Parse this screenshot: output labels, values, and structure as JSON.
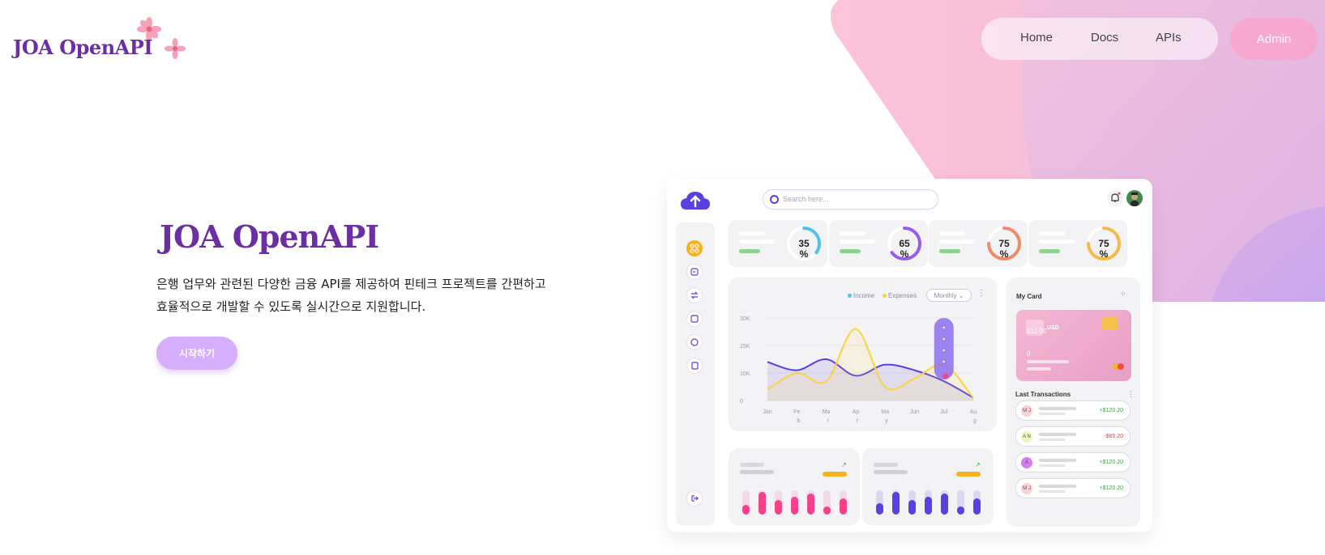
{
  "brand": {
    "logo_text": "JOA OpenAPI"
  },
  "nav": {
    "items": [
      {
        "label": "Home"
      },
      {
        "label": "Docs"
      },
      {
        "label": "APIs"
      }
    ],
    "admin_label": "Admin"
  },
  "hero": {
    "title": "JOA OpenAPI",
    "description_line1": "은행 업무와 관련된 다양한 금융 API를 제공하여 핀테크 프로젝트를 간편하고",
    "description_line2": "효율적으로 개발할 수 있도록 실시간으로 지원합니다.",
    "cta_label": "시작하기"
  },
  "dashboard": {
    "search_placeholder": "Search here...",
    "stats": [
      {
        "value": "35",
        "unit": "%",
        "percent": 35,
        "color": "#4fc3e8"
      },
      {
        "value": "65",
        "unit": "%",
        "percent": 65,
        "color": "#9a5cf0"
      },
      {
        "value": "75",
        "unit": "%",
        "percent": 75,
        "color": "#f28a6a"
      },
      {
        "value": "75",
        "unit": "%",
        "percent": 75,
        "color": "#f7b84a"
      }
    ],
    "legend": {
      "income": "Income",
      "expenses": "Expenses",
      "period": "Monthly"
    },
    "my_card": {
      "title": "My Card",
      "amount": "$12.00",
      "currency": "USD",
      "number": "0"
    },
    "last_transactions": {
      "title": "Last Transactions",
      "items": [
        {
          "initials": "M J",
          "amount": "+$120.20",
          "positive": true,
          "avatar_color": "#fbd0d6"
        },
        {
          "initials": "A N",
          "amount": "-$85.20",
          "positive": false,
          "avatar_color": "#eef7b8"
        },
        {
          "initials": "A",
          "amount": "+$120.20",
          "positive": true,
          "avatar_color": "#d77cf0"
        },
        {
          "initials": "M J",
          "amount": "+$120.20",
          "positive": true,
          "avatar_color": "#fbd0d6"
        }
      ]
    },
    "sidebar_icons": [
      "apps-icon",
      "card-icon",
      "transfer-icon",
      "wallet-icon",
      "chat-icon",
      "document-icon"
    ],
    "logout_icon": "logout-icon",
    "colors": {
      "accent": "#6b2fa3",
      "income": "#5b3fe0",
      "expenses": "#fbd33b",
      "pink_bars": "#f7418b",
      "purple_bars": "#5b3fe0"
    }
  },
  "chart_data": {
    "type": "line",
    "categories": [
      "Jan",
      "Feb",
      "Mar",
      "Apr",
      "May",
      "Jun",
      "Jul",
      "Aug"
    ],
    "series": [
      {
        "name": "Income",
        "values": [
          14,
          11,
          15,
          9,
          13,
          11,
          7,
          1
        ],
        "color": "#5b3fe0"
      },
      {
        "name": "Expenses",
        "values": [
          4,
          10,
          7,
          26,
          5,
          8,
          13,
          1
        ],
        "color": "#fbd33b"
      }
    ],
    "ytick_labels": [
      "30K",
      "15K",
      "10K",
      "0"
    ],
    "xtick_labels": [
      {
        "top": "Jan",
        "bottom": ""
      },
      {
        "top": "Fe",
        "bottom": "b"
      },
      {
        "top": "Ma",
        "bottom": "r"
      },
      {
        "top": "Ap",
        "bottom": "r"
      },
      {
        "top": "Ma",
        "bottom": "y"
      },
      {
        "top": "Jun",
        "bottom": ""
      },
      {
        "top": "Jul",
        "bottom": ""
      },
      {
        "top": "Au",
        "bottom": "g"
      }
    ],
    "ylim": [
      0,
      30
    ],
    "grid": true
  },
  "bar_cards": [
    {
      "values": [
        12,
        28,
        18,
        22,
        26,
        10,
        20
      ],
      "color": "#f7418b"
    },
    {
      "values": [
        14,
        28,
        18,
        22,
        26,
        10,
        20
      ],
      "color": "#5b3fe0"
    }
  ]
}
